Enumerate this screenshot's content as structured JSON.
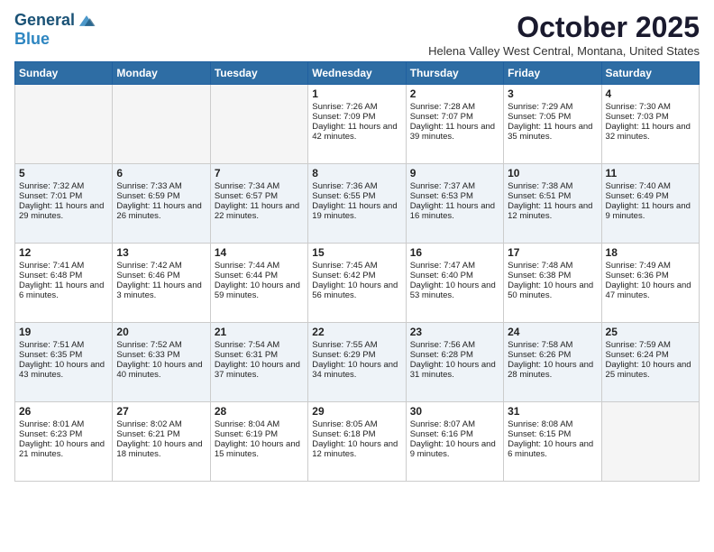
{
  "logo": {
    "line1": "General",
    "line2": "Blue"
  },
  "title": "October 2025",
  "location": "Helena Valley West Central, Montana, United States",
  "days_of_week": [
    "Sunday",
    "Monday",
    "Tuesday",
    "Wednesday",
    "Thursday",
    "Friday",
    "Saturday"
  ],
  "weeks": [
    [
      {
        "day": null,
        "data": []
      },
      {
        "day": null,
        "data": []
      },
      {
        "day": null,
        "data": []
      },
      {
        "day": "1",
        "data": [
          "Sunrise: 7:26 AM",
          "Sunset: 7:09 PM",
          "Daylight: 11 hours and 42 minutes."
        ]
      },
      {
        "day": "2",
        "data": [
          "Sunrise: 7:28 AM",
          "Sunset: 7:07 PM",
          "Daylight: 11 hours and 39 minutes."
        ]
      },
      {
        "day": "3",
        "data": [
          "Sunrise: 7:29 AM",
          "Sunset: 7:05 PM",
          "Daylight: 11 hours and 35 minutes."
        ]
      },
      {
        "day": "4",
        "data": [
          "Sunrise: 7:30 AM",
          "Sunset: 7:03 PM",
          "Daylight: 11 hours and 32 minutes."
        ]
      }
    ],
    [
      {
        "day": "5",
        "data": [
          "Sunrise: 7:32 AM",
          "Sunset: 7:01 PM",
          "Daylight: 11 hours and 29 minutes."
        ]
      },
      {
        "day": "6",
        "data": [
          "Sunrise: 7:33 AM",
          "Sunset: 6:59 PM",
          "Daylight: 11 hours and 26 minutes."
        ]
      },
      {
        "day": "7",
        "data": [
          "Sunrise: 7:34 AM",
          "Sunset: 6:57 PM",
          "Daylight: 11 hours and 22 minutes."
        ]
      },
      {
        "day": "8",
        "data": [
          "Sunrise: 7:36 AM",
          "Sunset: 6:55 PM",
          "Daylight: 11 hours and 19 minutes."
        ]
      },
      {
        "day": "9",
        "data": [
          "Sunrise: 7:37 AM",
          "Sunset: 6:53 PM",
          "Daylight: 11 hours and 16 minutes."
        ]
      },
      {
        "day": "10",
        "data": [
          "Sunrise: 7:38 AM",
          "Sunset: 6:51 PM",
          "Daylight: 11 hours and 12 minutes."
        ]
      },
      {
        "day": "11",
        "data": [
          "Sunrise: 7:40 AM",
          "Sunset: 6:49 PM",
          "Daylight: 11 hours and 9 minutes."
        ]
      }
    ],
    [
      {
        "day": "12",
        "data": [
          "Sunrise: 7:41 AM",
          "Sunset: 6:48 PM",
          "Daylight: 11 hours and 6 minutes."
        ]
      },
      {
        "day": "13",
        "data": [
          "Sunrise: 7:42 AM",
          "Sunset: 6:46 PM",
          "Daylight: 11 hours and 3 minutes."
        ]
      },
      {
        "day": "14",
        "data": [
          "Sunrise: 7:44 AM",
          "Sunset: 6:44 PM",
          "Daylight: 10 hours and 59 minutes."
        ]
      },
      {
        "day": "15",
        "data": [
          "Sunrise: 7:45 AM",
          "Sunset: 6:42 PM",
          "Daylight: 10 hours and 56 minutes."
        ]
      },
      {
        "day": "16",
        "data": [
          "Sunrise: 7:47 AM",
          "Sunset: 6:40 PM",
          "Daylight: 10 hours and 53 minutes."
        ]
      },
      {
        "day": "17",
        "data": [
          "Sunrise: 7:48 AM",
          "Sunset: 6:38 PM",
          "Daylight: 10 hours and 50 minutes."
        ]
      },
      {
        "day": "18",
        "data": [
          "Sunrise: 7:49 AM",
          "Sunset: 6:36 PM",
          "Daylight: 10 hours and 47 minutes."
        ]
      }
    ],
    [
      {
        "day": "19",
        "data": [
          "Sunrise: 7:51 AM",
          "Sunset: 6:35 PM",
          "Daylight: 10 hours and 43 minutes."
        ]
      },
      {
        "day": "20",
        "data": [
          "Sunrise: 7:52 AM",
          "Sunset: 6:33 PM",
          "Daylight: 10 hours and 40 minutes."
        ]
      },
      {
        "day": "21",
        "data": [
          "Sunrise: 7:54 AM",
          "Sunset: 6:31 PM",
          "Daylight: 10 hours and 37 minutes."
        ]
      },
      {
        "day": "22",
        "data": [
          "Sunrise: 7:55 AM",
          "Sunset: 6:29 PM",
          "Daylight: 10 hours and 34 minutes."
        ]
      },
      {
        "day": "23",
        "data": [
          "Sunrise: 7:56 AM",
          "Sunset: 6:28 PM",
          "Daylight: 10 hours and 31 minutes."
        ]
      },
      {
        "day": "24",
        "data": [
          "Sunrise: 7:58 AM",
          "Sunset: 6:26 PM",
          "Daylight: 10 hours and 28 minutes."
        ]
      },
      {
        "day": "25",
        "data": [
          "Sunrise: 7:59 AM",
          "Sunset: 6:24 PM",
          "Daylight: 10 hours and 25 minutes."
        ]
      }
    ],
    [
      {
        "day": "26",
        "data": [
          "Sunrise: 8:01 AM",
          "Sunset: 6:23 PM",
          "Daylight: 10 hours and 21 minutes."
        ]
      },
      {
        "day": "27",
        "data": [
          "Sunrise: 8:02 AM",
          "Sunset: 6:21 PM",
          "Daylight: 10 hours and 18 minutes."
        ]
      },
      {
        "day": "28",
        "data": [
          "Sunrise: 8:04 AM",
          "Sunset: 6:19 PM",
          "Daylight: 10 hours and 15 minutes."
        ]
      },
      {
        "day": "29",
        "data": [
          "Sunrise: 8:05 AM",
          "Sunset: 6:18 PM",
          "Daylight: 10 hours and 12 minutes."
        ]
      },
      {
        "day": "30",
        "data": [
          "Sunrise: 8:07 AM",
          "Sunset: 6:16 PM",
          "Daylight: 10 hours and 9 minutes."
        ]
      },
      {
        "day": "31",
        "data": [
          "Sunrise: 8:08 AM",
          "Sunset: 6:15 PM",
          "Daylight: 10 hours and 6 minutes."
        ]
      },
      {
        "day": null,
        "data": []
      }
    ]
  ]
}
